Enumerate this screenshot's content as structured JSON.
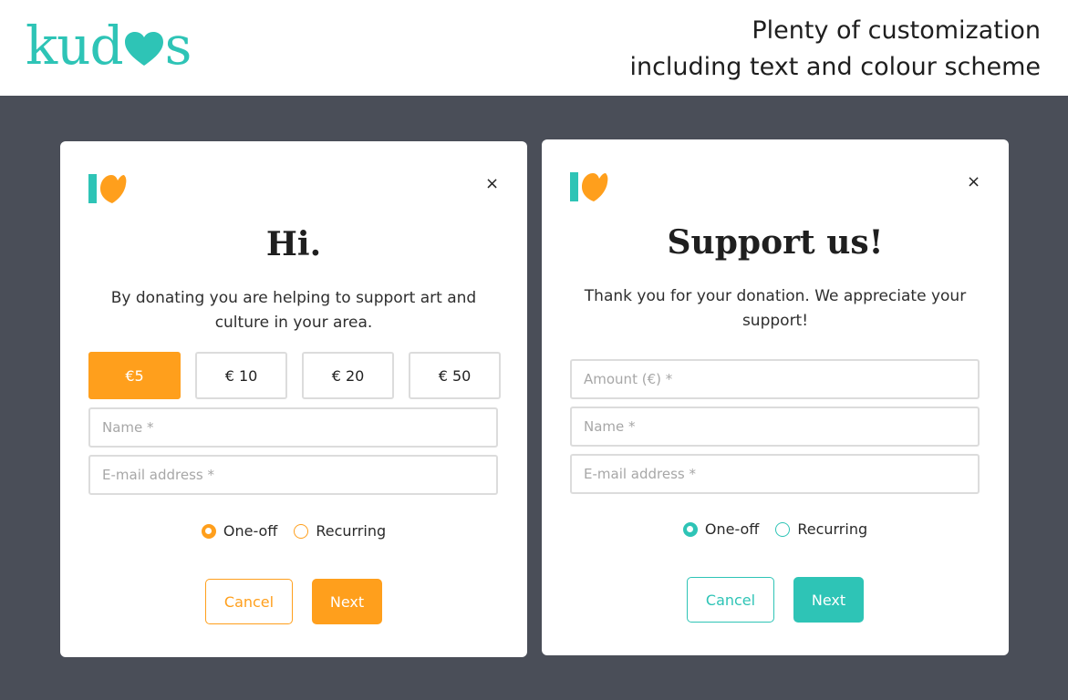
{
  "brand": {
    "name_left": "kud",
    "name_right": "s",
    "color": "#2ec4b6"
  },
  "tagline": [
    "Plenty of customization",
    "including text and colour scheme"
  ],
  "left_card": {
    "accent": "#ff9f1c",
    "logo_bar": "#2ec4b6",
    "logo_heart": "#ff9f1c",
    "close_label": "×",
    "title": "Hi.",
    "description": "By donating you are helping to support art and culture in your area.",
    "amounts": [
      {
        "label": "€5",
        "selected": true
      },
      {
        "label": "€ 10",
        "selected": false
      },
      {
        "label": "€ 20",
        "selected": false
      },
      {
        "label": "€ 50",
        "selected": false
      }
    ],
    "name_placeholder": "Name *",
    "email_placeholder": "E-mail address *",
    "frequency": {
      "options": [
        "One-off",
        "Recurring"
      ],
      "selected": "One-off"
    },
    "cancel_label": "Cancel",
    "next_label": "Next"
  },
  "right_card": {
    "accent": "#2ec4b6",
    "logo_bar": "#2ec4b6",
    "logo_heart": "#ff9f1c",
    "close_label": "×",
    "title": "Support us!",
    "description": "Thank you for your donation. We appreciate your support!",
    "amount_placeholder": "Amount (€) *",
    "name_placeholder": "Name *",
    "email_placeholder": "E-mail address *",
    "frequency": {
      "options": [
        "One-off",
        "Recurring"
      ],
      "selected": "One-off"
    },
    "cancel_label": "Cancel",
    "next_label": "Next"
  }
}
